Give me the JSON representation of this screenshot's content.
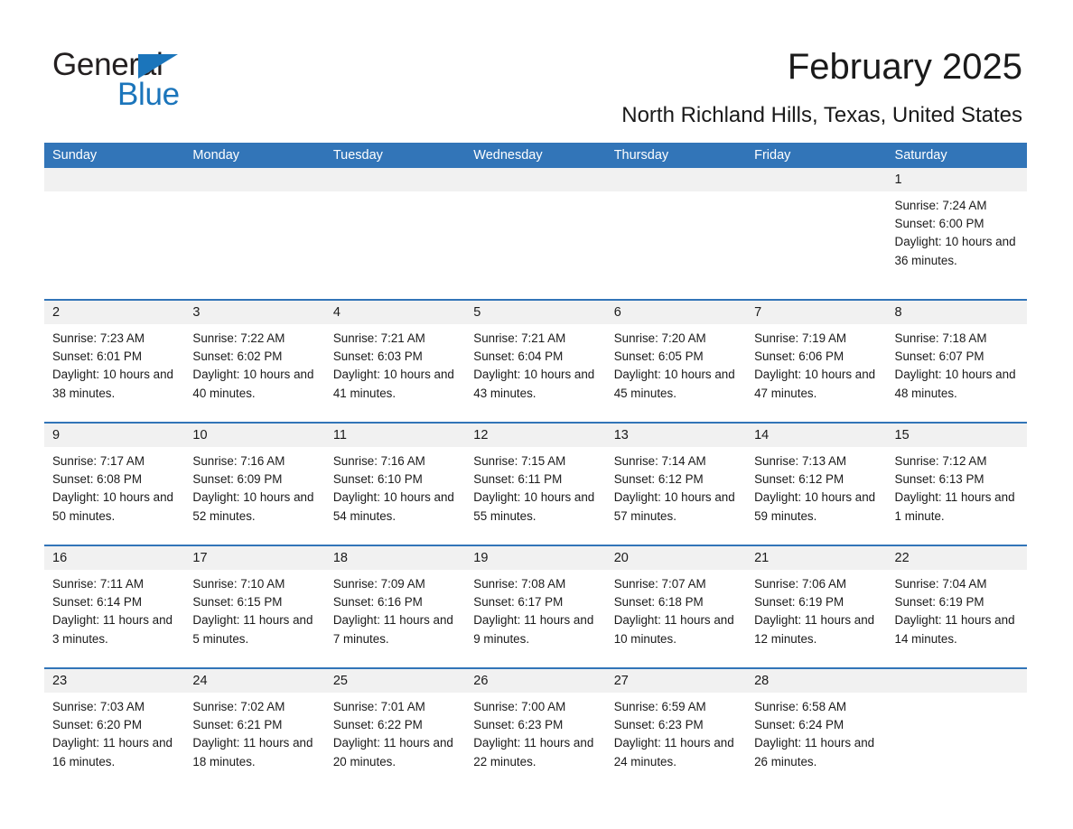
{
  "brand": {
    "logo_text_top": "General",
    "logo_text_bottom": "Blue",
    "logo_black": "#231f20",
    "logo_blue": "#1b75bb"
  },
  "header": {
    "title": "February 2025",
    "subtitle": "North Richland Hills, Texas, United States"
  },
  "theme": {
    "accent_blue": "#3275b8",
    "day_band_gray": "#f1f1f1",
    "text": "#1a1a1a"
  },
  "weekdays": [
    "Sunday",
    "Monday",
    "Tuesday",
    "Wednesday",
    "Thursday",
    "Friday",
    "Saturday"
  ],
  "weeks": [
    [
      {
        "day": "",
        "sunrise": "",
        "sunset": "",
        "daylight": "",
        "empty": true
      },
      {
        "day": "",
        "sunrise": "",
        "sunset": "",
        "daylight": "",
        "empty": true
      },
      {
        "day": "",
        "sunrise": "",
        "sunset": "",
        "daylight": "",
        "empty": true
      },
      {
        "day": "",
        "sunrise": "",
        "sunset": "",
        "daylight": "",
        "empty": true
      },
      {
        "day": "",
        "sunrise": "",
        "sunset": "",
        "daylight": "",
        "empty": true
      },
      {
        "day": "",
        "sunrise": "",
        "sunset": "",
        "daylight": "",
        "empty": true
      },
      {
        "day": "1",
        "sunrise": "Sunrise: 7:24 AM",
        "sunset": "Sunset: 6:00 PM",
        "daylight": "Daylight: 10 hours and 36 minutes."
      }
    ],
    [
      {
        "day": "2",
        "sunrise": "Sunrise: 7:23 AM",
        "sunset": "Sunset: 6:01 PM",
        "daylight": "Daylight: 10 hours and 38 minutes."
      },
      {
        "day": "3",
        "sunrise": "Sunrise: 7:22 AM",
        "sunset": "Sunset: 6:02 PM",
        "daylight": "Daylight: 10 hours and 40 minutes."
      },
      {
        "day": "4",
        "sunrise": "Sunrise: 7:21 AM",
        "sunset": "Sunset: 6:03 PM",
        "daylight": "Daylight: 10 hours and 41 minutes."
      },
      {
        "day": "5",
        "sunrise": "Sunrise: 7:21 AM",
        "sunset": "Sunset: 6:04 PM",
        "daylight": "Daylight: 10 hours and 43 minutes."
      },
      {
        "day": "6",
        "sunrise": "Sunrise: 7:20 AM",
        "sunset": "Sunset: 6:05 PM",
        "daylight": "Daylight: 10 hours and 45 minutes."
      },
      {
        "day": "7",
        "sunrise": "Sunrise: 7:19 AM",
        "sunset": "Sunset: 6:06 PM",
        "daylight": "Daylight: 10 hours and 47 minutes."
      },
      {
        "day": "8",
        "sunrise": "Sunrise: 7:18 AM",
        "sunset": "Sunset: 6:07 PM",
        "daylight": "Daylight: 10 hours and 48 minutes."
      }
    ],
    [
      {
        "day": "9",
        "sunrise": "Sunrise: 7:17 AM",
        "sunset": "Sunset: 6:08 PM",
        "daylight": "Daylight: 10 hours and 50 minutes."
      },
      {
        "day": "10",
        "sunrise": "Sunrise: 7:16 AM",
        "sunset": "Sunset: 6:09 PM",
        "daylight": "Daylight: 10 hours and 52 minutes."
      },
      {
        "day": "11",
        "sunrise": "Sunrise: 7:16 AM",
        "sunset": "Sunset: 6:10 PM",
        "daylight": "Daylight: 10 hours and 54 minutes."
      },
      {
        "day": "12",
        "sunrise": "Sunrise: 7:15 AM",
        "sunset": "Sunset: 6:11 PM",
        "daylight": "Daylight: 10 hours and 55 minutes."
      },
      {
        "day": "13",
        "sunrise": "Sunrise: 7:14 AM",
        "sunset": "Sunset: 6:12 PM",
        "daylight": "Daylight: 10 hours and 57 minutes."
      },
      {
        "day": "14",
        "sunrise": "Sunrise: 7:13 AM",
        "sunset": "Sunset: 6:12 PM",
        "daylight": "Daylight: 10 hours and 59 minutes."
      },
      {
        "day": "15",
        "sunrise": "Sunrise: 7:12 AM",
        "sunset": "Sunset: 6:13 PM",
        "daylight": "Daylight: 11 hours and 1 minute."
      }
    ],
    [
      {
        "day": "16",
        "sunrise": "Sunrise: 7:11 AM",
        "sunset": "Sunset: 6:14 PM",
        "daylight": "Daylight: 11 hours and 3 minutes."
      },
      {
        "day": "17",
        "sunrise": "Sunrise: 7:10 AM",
        "sunset": "Sunset: 6:15 PM",
        "daylight": "Daylight: 11 hours and 5 minutes."
      },
      {
        "day": "18",
        "sunrise": "Sunrise: 7:09 AM",
        "sunset": "Sunset: 6:16 PM",
        "daylight": "Daylight: 11 hours and 7 minutes."
      },
      {
        "day": "19",
        "sunrise": "Sunrise: 7:08 AM",
        "sunset": "Sunset: 6:17 PM",
        "daylight": "Daylight: 11 hours and 9 minutes."
      },
      {
        "day": "20",
        "sunrise": "Sunrise: 7:07 AM",
        "sunset": "Sunset: 6:18 PM",
        "daylight": "Daylight: 11 hours and 10 minutes."
      },
      {
        "day": "21",
        "sunrise": "Sunrise: 7:06 AM",
        "sunset": "Sunset: 6:19 PM",
        "daylight": "Daylight: 11 hours and 12 minutes."
      },
      {
        "day": "22",
        "sunrise": "Sunrise: 7:04 AM",
        "sunset": "Sunset: 6:19 PM",
        "daylight": "Daylight: 11 hours and 14 minutes."
      }
    ],
    [
      {
        "day": "23",
        "sunrise": "Sunrise: 7:03 AM",
        "sunset": "Sunset: 6:20 PM",
        "daylight": "Daylight: 11 hours and 16 minutes."
      },
      {
        "day": "24",
        "sunrise": "Sunrise: 7:02 AM",
        "sunset": "Sunset: 6:21 PM",
        "daylight": "Daylight: 11 hours and 18 minutes."
      },
      {
        "day": "25",
        "sunrise": "Sunrise: 7:01 AM",
        "sunset": "Sunset: 6:22 PM",
        "daylight": "Daylight: 11 hours and 20 minutes."
      },
      {
        "day": "26",
        "sunrise": "Sunrise: 7:00 AM",
        "sunset": "Sunset: 6:23 PM",
        "daylight": "Daylight: 11 hours and 22 minutes."
      },
      {
        "day": "27",
        "sunrise": "Sunrise: 6:59 AM",
        "sunset": "Sunset: 6:23 PM",
        "daylight": "Daylight: 11 hours and 24 minutes."
      },
      {
        "day": "28",
        "sunrise": "Sunrise: 6:58 AM",
        "sunset": "Sunset: 6:24 PM",
        "daylight": "Daylight: 11 hours and 26 minutes."
      },
      {
        "day": "",
        "sunrise": "",
        "sunset": "",
        "daylight": "",
        "empty": true
      }
    ]
  ]
}
